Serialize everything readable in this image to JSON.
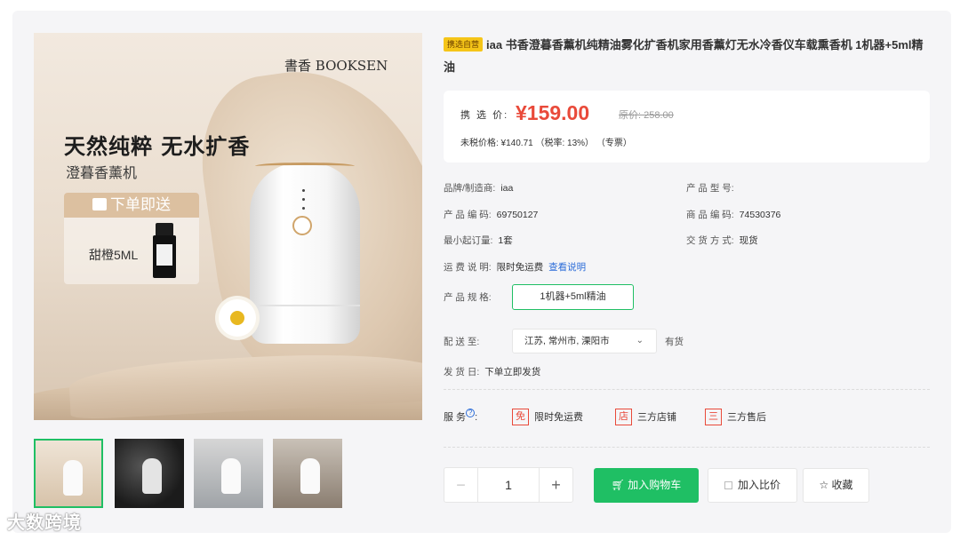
{
  "gallery": {
    "brand_mark": "書香 BOOKSEN",
    "headline": "天然纯粹  无水扩香",
    "subline": "澄暮香薰机",
    "gift_tag": "下单即送",
    "gift_item": "甜橙5ML",
    "thumbnail_count": 4,
    "active_thumbnail": 1
  },
  "watermark": "大数跨境",
  "product": {
    "badge": "携选自营",
    "title": "iaa 书香澄暮香薰机纯精油雾化扩香机家用香薰灯无水冷香仪车载熏香机 1机器+5ml精油"
  },
  "price": {
    "label": "携 选 价:",
    "value": "¥159.00",
    "original": "原价: 258.00",
    "tax_line": "未税价格: ¥140.71 （税率: 13%） （专票）"
  },
  "attributes": {
    "brand_label": "品牌/制造商:",
    "brand_value": "iaa",
    "model_label": "产 品 型 号:",
    "model_value": "",
    "code_label": "产 品 编 码:",
    "code_value": "69750127",
    "sku_label": "商 品 编 码:",
    "sku_value": "74530376",
    "moq_label": "最小起订量:",
    "moq_value": "1套",
    "delivery_label": "交 货 方 式:",
    "delivery_value": "现货",
    "freight_label": "运 费 说 明:",
    "freight_value": "限时免运费",
    "freight_link": "查看说明",
    "spec_label": "产 品 规 格:",
    "spec_option": "1机器+5ml精油",
    "ship_to_label": "配  送  至:",
    "ship_to_value": "江苏, 常州市, 溧阳市",
    "stock": "有货",
    "ship_label": "发  货  日:",
    "ship_value": "下单立即发货"
  },
  "services": {
    "label": "服   务",
    "items": [
      {
        "icon": "免",
        "label": "限时免运费"
      },
      {
        "icon": "店",
        "label": "三方店铺"
      },
      {
        "icon": "三",
        "label": "三方售后"
      }
    ]
  },
  "purchase": {
    "quantity": "1",
    "minus": "−",
    "plus": "+",
    "add_to_cart": "加入购物车",
    "compare": "加入比价",
    "favorite": "收藏"
  },
  "colors": {
    "accent_green": "#1fbf64",
    "price_red": "#e94a3a",
    "link_blue": "#2b6cd8"
  }
}
